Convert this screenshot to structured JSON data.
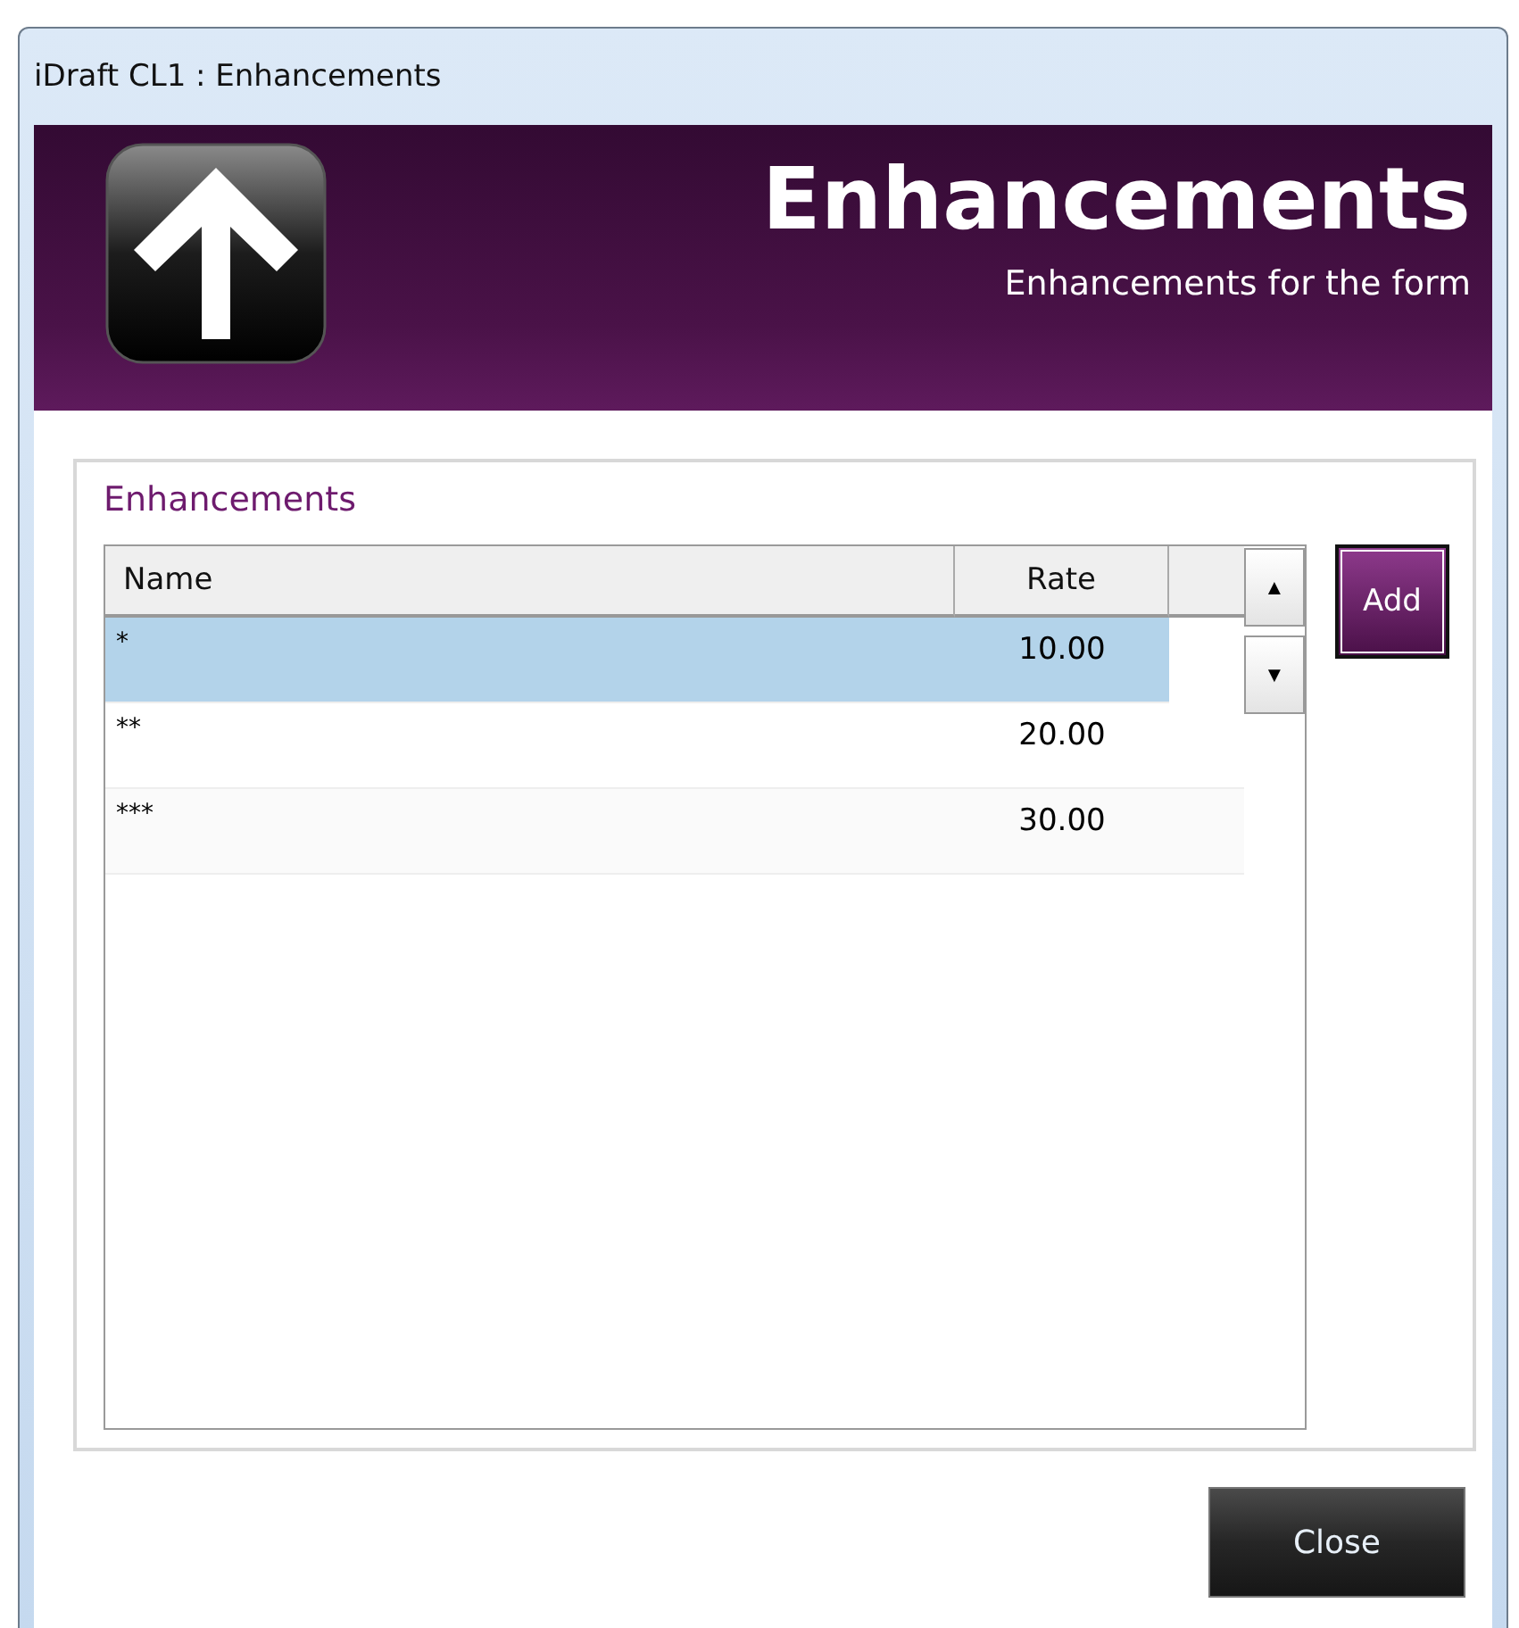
{
  "window": {
    "title": "iDraft CL1 : Enhancements"
  },
  "banner": {
    "title": "Enhancements",
    "subtitle": "Enhancements for the form"
  },
  "group": {
    "title": "Enhancements"
  },
  "table": {
    "columns": [
      "Name",
      "Rate"
    ],
    "rows": [
      {
        "name": "*",
        "rate": "10.00",
        "selected": true
      },
      {
        "name": "**",
        "rate": "20.00",
        "selected": false
      },
      {
        "name": "***",
        "rate": "30.00",
        "selected": false
      }
    ]
  },
  "buttons": {
    "move_up": "▲",
    "move_down": "▼",
    "add": "Add",
    "close": "Close"
  }
}
